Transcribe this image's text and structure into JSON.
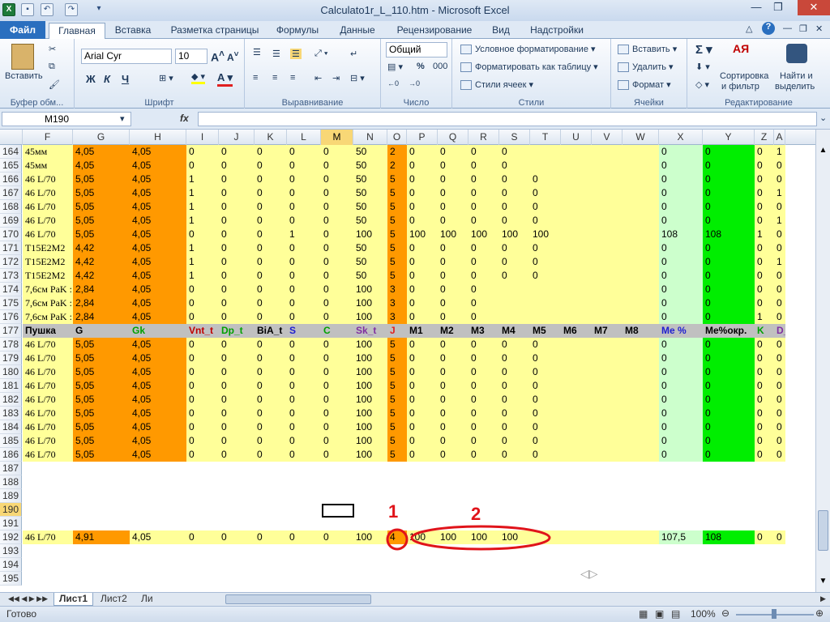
{
  "window": {
    "title": "Calculato1r_L_110.htm  -  Microsoft Excel"
  },
  "ribbon_tabs": [
    "Файл",
    "Главная",
    "Вставка",
    "Разметка страницы",
    "Формулы",
    "Данные",
    "Рецензирование",
    "Вид",
    "Надстройки"
  ],
  "ribbon": {
    "paste_label": "Вставить",
    "clipboard_group": "Буфер обм...",
    "font_name": "Arial Cyr",
    "font_size": "10",
    "font_group": "Шрифт",
    "bold": "Ж",
    "italic": "К",
    "underline": "Ч",
    "align_group": "Выравнивание",
    "number_format": "Общий",
    "number_group": "Число",
    "cond_format": "Условное форматирование",
    "format_table": "Форматировать как таблицу",
    "cell_styles": "Стили ячеек",
    "styles_group": "Стили",
    "insert": "Вставить",
    "delete": "Удалить",
    "format": "Формат",
    "cells_group": "Ячейки",
    "sort_filter_1": "Сортировка",
    "sort_filter_2": "и фильтр",
    "find_1": "Найти и",
    "find_2": "выделить",
    "editing_group": "Редактирование"
  },
  "formula_bar": {
    "name_box": "M190",
    "fx": "fx",
    "formula": ""
  },
  "columns": [
    "F",
    "G",
    "H",
    "I",
    "J",
    "K",
    "L",
    "M",
    "N",
    "O",
    "P",
    "Q",
    "R",
    "S",
    "T",
    "U",
    "V",
    "W",
    "X",
    "Y",
    "Z",
    "A"
  ],
  "selected_column": "M",
  "selected_row": "190",
  "rows": [
    {
      "n": "164",
      "c": [
        "45мм",
        "4,05",
        "4,05",
        "0",
        "0",
        "0",
        "0",
        "0",
        "50",
        "2",
        "0",
        "0",
        "0",
        "0",
        "",
        "",
        "",
        "",
        "0",
        "0",
        "0",
        "1"
      ]
    },
    {
      "n": "165",
      "c": [
        "45мм",
        "4,05",
        "4,05",
        "0",
        "0",
        "0",
        "0",
        "0",
        "50",
        "2",
        "0",
        "0",
        "0",
        "0",
        "",
        "",
        "",
        "",
        "0",
        "0",
        "0",
        "0"
      ]
    },
    {
      "n": "166",
      "c": [
        "46 L/70",
        "5,05",
        "4,05",
        "1",
        "0",
        "0",
        "0",
        "0",
        "50",
        "5",
        "0",
        "0",
        "0",
        "0",
        "0",
        "",
        "",
        "",
        "0",
        "0",
        "0",
        "0"
      ]
    },
    {
      "n": "167",
      "c": [
        "46 L/70",
        "5,05",
        "4,05",
        "1",
        "0",
        "0",
        "0",
        "0",
        "50",
        "5",
        "0",
        "0",
        "0",
        "0",
        "0",
        "",
        "",
        "",
        "0",
        "0",
        "0",
        "1"
      ]
    },
    {
      "n": "168",
      "c": [
        "46 L/70",
        "5,05",
        "4,05",
        "1",
        "0",
        "0",
        "0",
        "0",
        "50",
        "5",
        "0",
        "0",
        "0",
        "0",
        "0",
        "",
        "",
        "",
        "0",
        "0",
        "0",
        "0"
      ]
    },
    {
      "n": "169",
      "c": [
        "46 L/70",
        "5,05",
        "4,05",
        "1",
        "0",
        "0",
        "0",
        "0",
        "50",
        "5",
        "0",
        "0",
        "0",
        "0",
        "0",
        "",
        "",
        "",
        "0",
        "0",
        "0",
        "1"
      ]
    },
    {
      "n": "170",
      "c": [
        "46 L/70",
        "5,05",
        "4,05",
        "0",
        "0",
        "0",
        "1",
        "0",
        "100",
        "5",
        "100",
        "100",
        "100",
        "100",
        "100",
        "",
        "",
        "",
        "108",
        "108",
        "1",
        "0"
      ]
    },
    {
      "n": "171",
      "c": [
        "T15E2M2",
        "4,42",
        "4,05",
        "1",
        "0",
        "0",
        "0",
        "0",
        "50",
        "5",
        "0",
        "0",
        "0",
        "0",
        "0",
        "",
        "",
        "",
        "0",
        "0",
        "0",
        "0"
      ]
    },
    {
      "n": "172",
      "c": [
        "T15E2M2",
        "4,42",
        "4,05",
        "1",
        "0",
        "0",
        "0",
        "0",
        "50",
        "5",
        "0",
        "0",
        "0",
        "0",
        "0",
        "",
        "",
        "",
        "0",
        "0",
        "0",
        "1"
      ]
    },
    {
      "n": "173",
      "c": [
        "T15E2M2",
        "4,42",
        "4,05",
        "1",
        "0",
        "0",
        "0",
        "0",
        "50",
        "5",
        "0",
        "0",
        "0",
        "0",
        "0",
        "",
        "",
        "",
        "0",
        "0",
        "0",
        "0"
      ]
    },
    {
      "n": "174",
      "c": [
        "7,6см PaK :",
        "2,84",
        "4,05",
        "0",
        "0",
        "0",
        "0",
        "0",
        "100",
        "3",
        "0",
        "0",
        "0",
        "",
        "",
        "",
        "",
        "",
        "0",
        "0",
        "0",
        "0"
      ]
    },
    {
      "n": "175",
      "c": [
        "7,6см PaK :",
        "2,84",
        "4,05",
        "0",
        "0",
        "0",
        "0",
        "0",
        "100",
        "3",
        "0",
        "0",
        "0",
        "",
        "",
        "",
        "",
        "",
        "0",
        "0",
        "0",
        "0"
      ]
    },
    {
      "n": "176",
      "c": [
        "7,6см PaK :",
        "2,84",
        "4,05",
        "0",
        "0",
        "0",
        "0",
        "0",
        "100",
        "3",
        "0",
        "0",
        "0",
        "",
        "",
        "",
        "",
        "",
        "0",
        "0",
        "1",
        "0"
      ]
    },
    {
      "n": "177",
      "header": true,
      "c": [
        "Пушка",
        "G",
        "Gk",
        "Vnt_t",
        "Dp_t",
        "BiA_t",
        "S",
        "C",
        "Sk_t",
        "J",
        "M1",
        "M2",
        "M3",
        "M4",
        "M5",
        "M6",
        "M7",
        "M8",
        "Me %",
        "Me%окр.",
        "K",
        "D_"
      ]
    },
    {
      "n": "178",
      "c": [
        "46 L/70",
        "5,05",
        "4,05",
        "0",
        "0",
        "0",
        "0",
        "0",
        "100",
        "5",
        "0",
        "0",
        "0",
        "0",
        "0",
        "",
        "",
        "",
        "0",
        "0",
        "0",
        "0"
      ]
    },
    {
      "n": "179",
      "c": [
        "46 L/70",
        "5,05",
        "4,05",
        "0",
        "0",
        "0",
        "0",
        "0",
        "100",
        "5",
        "0",
        "0",
        "0",
        "0",
        "0",
        "",
        "",
        "",
        "0",
        "0",
        "0",
        "0"
      ]
    },
    {
      "n": "180",
      "c": [
        "46 L/70",
        "5,05",
        "4,05",
        "0",
        "0",
        "0",
        "0",
        "0",
        "100",
        "5",
        "0",
        "0",
        "0",
        "0",
        "0",
        "",
        "",
        "",
        "0",
        "0",
        "0",
        "0"
      ]
    },
    {
      "n": "181",
      "c": [
        "46 L/70",
        "5,05",
        "4,05",
        "0",
        "0",
        "0",
        "0",
        "0",
        "100",
        "5",
        "0",
        "0",
        "0",
        "0",
        "0",
        "",
        "",
        "",
        "0",
        "0",
        "0",
        "0"
      ]
    },
    {
      "n": "182",
      "c": [
        "46 L/70",
        "5,05",
        "4,05",
        "0",
        "0",
        "0",
        "0",
        "0",
        "100",
        "5",
        "0",
        "0",
        "0",
        "0",
        "0",
        "",
        "",
        "",
        "0",
        "0",
        "0",
        "0"
      ]
    },
    {
      "n": "183",
      "c": [
        "46 L/70",
        "5,05",
        "4,05",
        "0",
        "0",
        "0",
        "0",
        "0",
        "100",
        "5",
        "0",
        "0",
        "0",
        "0",
        "0",
        "",
        "",
        "",
        "0",
        "0",
        "0",
        "0"
      ]
    },
    {
      "n": "184",
      "c": [
        "46 L/70",
        "5,05",
        "4,05",
        "0",
        "0",
        "0",
        "0",
        "0",
        "100",
        "5",
        "0",
        "0",
        "0",
        "0",
        "0",
        "",
        "",
        "",
        "0",
        "0",
        "0",
        "0"
      ]
    },
    {
      "n": "185",
      "c": [
        "46 L/70",
        "5,05",
        "4,05",
        "0",
        "0",
        "0",
        "0",
        "0",
        "100",
        "5",
        "0",
        "0",
        "0",
        "0",
        "0",
        "",
        "",
        "",
        "0",
        "0",
        "0",
        "0"
      ]
    },
    {
      "n": "186",
      "c": [
        "46 L/70",
        "5,05",
        "4,05",
        "0",
        "0",
        "0",
        "0",
        "0",
        "100",
        "5",
        "0",
        "0",
        "0",
        "0",
        "0",
        "",
        "",
        "",
        "0",
        "0",
        "0",
        "0"
      ]
    },
    {
      "n": "187",
      "blank": true,
      "c": []
    },
    {
      "n": "188",
      "blank": true,
      "c": []
    },
    {
      "n": "189",
      "blank": true,
      "c": []
    },
    {
      "n": "190",
      "blank": true,
      "c": []
    },
    {
      "n": "191",
      "blank": true,
      "c": []
    },
    {
      "n": "192",
      "c": [
        "46 L/70",
        "4,91",
        "4,05",
        "0",
        "0",
        "0",
        "0",
        "0",
        "100",
        "4",
        "100",
        "100",
        "100",
        "100",
        "",
        "",
        "",
        "",
        "107,5",
        "108",
        "0",
        "0"
      ]
    },
    {
      "n": "193",
      "blank": true,
      "c": []
    },
    {
      "n": "194",
      "blank": true,
      "c": []
    },
    {
      "n": "195",
      "blank": true,
      "c": []
    }
  ],
  "header_colors": [
    "#000000",
    "#000000",
    "#00a000",
    "#c00000",
    "#00a000",
    "#000000",
    "#2020d0",
    "#00a000",
    "#8030a0",
    "#e02020",
    "#000000",
    "#000000",
    "#000000",
    "#000000",
    "#000000",
    "#000000",
    "#000000",
    "#000000",
    "#2020d0",
    "#000000",
    "#00a000",
    "#8030a0"
  ],
  "annotations": [
    "1",
    "2"
  ],
  "sheets": [
    "Лист1",
    "Лист2",
    "Ли"
  ],
  "status": {
    "ready": "Готово",
    "zoom": "100%"
  },
  "colors": {
    "orange": "#ff9900",
    "yellow": "#ffff99",
    "light_green": "#ccffcc",
    "green": "#00ee00",
    "header_gray": "#c0c0c0",
    "annotation": "#e0141a"
  }
}
